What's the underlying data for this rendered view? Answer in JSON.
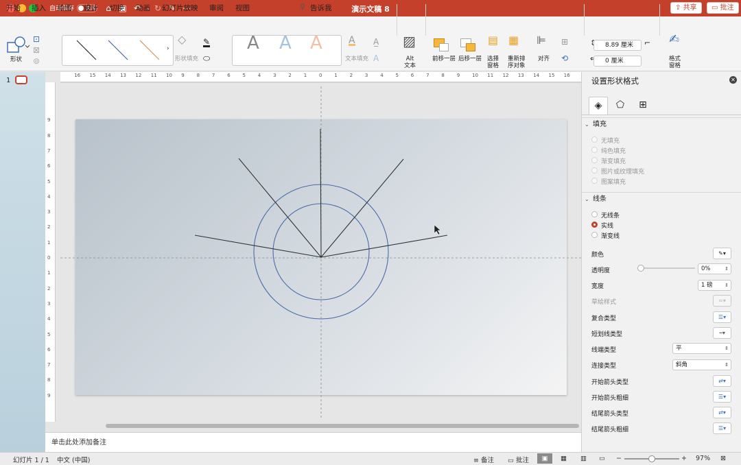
{
  "titlebar": {
    "autosave_label": "自动保存",
    "autosave_state": "关闭",
    "document_title": "演示文稿 8",
    "icons": [
      "home-icon",
      "save-icon",
      "undo-icon",
      "redo-icon",
      "edit-icon",
      "more-icon",
      "search-icon",
      "share-person-icon"
    ],
    "colors": {
      "bar": "#c4402b"
    }
  },
  "menu": {
    "tabs": [
      "开始",
      "插入",
      "绘图",
      "设计",
      "切换",
      "动画",
      "幻灯片放映",
      "审阅",
      "视图",
      "形状格式",
      "告诉我"
    ],
    "active_tab": "形状格式",
    "share_label": "共享",
    "comments_label": "批注"
  },
  "ribbon": {
    "shape_label": "形状",
    "shape_fill_label": "形状填充",
    "text_fill_label": "文本填充",
    "alt_text_label": "Alt\n文本",
    "bring_forward_label": "前移一层",
    "send_backward_label": "后移一层",
    "selection_pane_label": "选择\n窗格",
    "reorder_label": "重新排\n序对象",
    "align_label": "对齐",
    "format_pane_label": "格式\n窗格",
    "height_value": "8.89 厘米",
    "width_value": "0 厘米",
    "wordart_letters": [
      "A",
      "A",
      "A"
    ]
  },
  "thumbnails": {
    "slide_number": "1"
  },
  "ruler": {
    "h_ticks": [
      "16",
      "15",
      "14",
      "13",
      "12",
      "11",
      "10",
      "9",
      "8",
      "7",
      "6",
      "5",
      "4",
      "3",
      "2",
      "1",
      "0",
      "1",
      "2",
      "3",
      "4",
      "5",
      "6",
      "7",
      "8",
      "9",
      "10",
      "11",
      "12",
      "13",
      "14",
      "15",
      "16"
    ],
    "v_ticks": [
      "9",
      "8",
      "7",
      "6",
      "5",
      "4",
      "3",
      "2",
      "1",
      "0",
      "1",
      "2",
      "3",
      "4",
      "5",
      "6",
      "7",
      "8",
      "9"
    ]
  },
  "notes": {
    "placeholder": "单击此处添加备注"
  },
  "panel": {
    "title": "设置形状格式",
    "fill_section": "填充",
    "fill_options": [
      "无填充",
      "纯色填充",
      "渐变填充",
      "图片或纹理填充",
      "图案填充"
    ],
    "line_section": "线条",
    "line_options": [
      "无线条",
      "实线",
      "渐变线"
    ],
    "line_selected": "实线",
    "props": {
      "color": "颜色",
      "transparency": "透明度",
      "transparency_value": "0%",
      "transparency_level": 0,
      "width": "宽度",
      "width_value": "1 磅",
      "sketch_style": "草绘样式",
      "compound_type": "复合类型",
      "dash_type": "短划线类型",
      "cap_type": "线端类型",
      "cap_value": "平",
      "join_type": "连接类型",
      "join_value": "斜角",
      "begin_arrow_type": "开始箭头类型",
      "begin_arrow_size": "开始箭头粗细",
      "end_arrow_type": "结尾箭头类型",
      "end_arrow_size": "结尾箭头粗细"
    }
  },
  "status": {
    "slide_info": "幻灯片 1 / 1",
    "language": "中文 (中国)",
    "notes_label": "备注",
    "comments_label": "批注",
    "zoom_minus": "−",
    "zoom_plus": "+",
    "zoom": "97%",
    "zoom_level": 0.5
  },
  "slide_colors": {
    "line": "#3a3a3a",
    "circle": "#4a6aa8"
  }
}
